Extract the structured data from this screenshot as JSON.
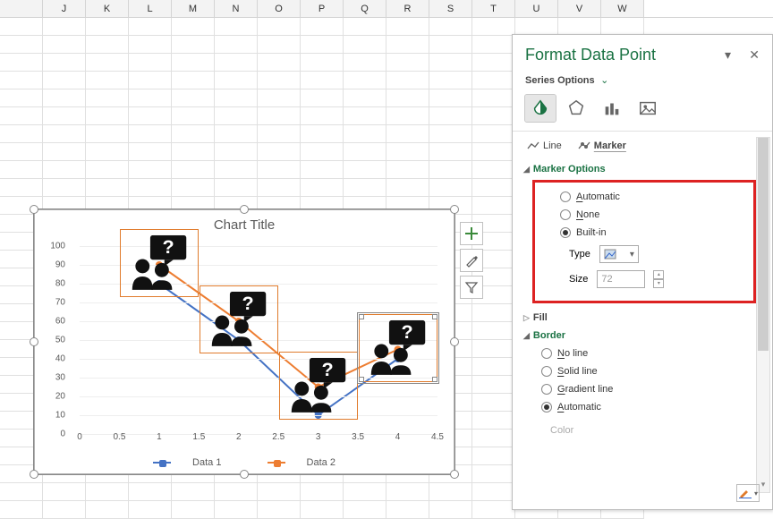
{
  "columns": [
    "",
    "J",
    "K",
    "L",
    "M",
    "N",
    "O",
    "P",
    "Q",
    "R",
    "S",
    "T",
    "U",
    "V",
    "W"
  ],
  "chart_data": {
    "type": "line",
    "title": "Chart Title",
    "xlabel": "",
    "ylabel": "",
    "xlim": [
      0,
      4.5
    ],
    "ylim": [
      0,
      100
    ],
    "y_ticks": [
      0,
      10,
      20,
      30,
      40,
      50,
      60,
      70,
      80,
      90,
      100
    ],
    "x_ticks": [
      0,
      0.5,
      1,
      1.5,
      2,
      2.5,
      3,
      3.5,
      4,
      4.5
    ],
    "series": [
      {
        "name": "Data 1",
        "color": "#4472c4",
        "x": [
          1,
          2,
          3,
          4
        ],
        "y": [
          80,
          50,
          10,
          40
        ]
      },
      {
        "name": "Data 2",
        "color": "#ed7d31",
        "x": [
          1,
          2,
          3,
          4
        ],
        "y": [
          90,
          60,
          25,
          45
        ]
      }
    ]
  },
  "legend": {
    "s1": "Data 1",
    "s2": "Data 2"
  },
  "side_buttons": {
    "add": "+",
    "brush": "brush",
    "filter": "filter"
  },
  "pane": {
    "title": "Format Data Point",
    "series_options": "Series Options",
    "tabs": {
      "line": "Line",
      "marker": "Marker"
    },
    "marker_options": "Marker Options",
    "radio": {
      "auto": "Automatic",
      "none": "None",
      "builtin": "Built-in"
    },
    "type_label": "Type",
    "size_label": "Size",
    "size_value": "72",
    "fill": "Fill",
    "border": "Border",
    "border_radio": {
      "noline": "No line",
      "solid": "Solid line",
      "gradient": "Gradient line",
      "auto": "Automatic"
    },
    "color": "Color"
  }
}
